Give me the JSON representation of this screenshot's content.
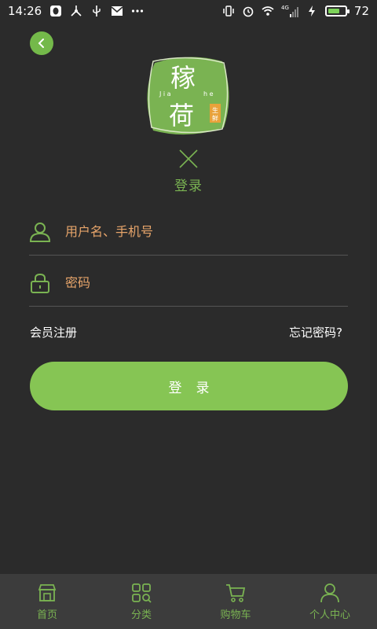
{
  "status_bar": {
    "time": "14:26",
    "network_label": "4G",
    "battery_level": "72",
    "battery_fraction": 0.72
  },
  "header": {
    "logo_text_top": "稼",
    "logo_text_bottom": "荷",
    "logo_pinyin_left": "J i a",
    "logo_pinyin_right": "h e",
    "logo_badge": "生鲜",
    "title": "登录"
  },
  "form": {
    "username_placeholder": "用户名、手机号",
    "password_placeholder": "密码",
    "register_label": "会员注册",
    "forgot_label": "忘记密码?",
    "login_label": "登录"
  },
  "bottom_nav": {
    "items": [
      {
        "label": "首页",
        "icon": "store-icon"
      },
      {
        "label": "分类",
        "icon": "category-icon"
      },
      {
        "label": "购物车",
        "icon": "cart-icon"
      },
      {
        "label": "个人中心",
        "icon": "user-icon"
      }
    ]
  },
  "colors": {
    "background": "#2b2b2b",
    "accent": "#86c554",
    "placeholder": "#e6a46a",
    "nav_bg": "#3c3c3c"
  }
}
